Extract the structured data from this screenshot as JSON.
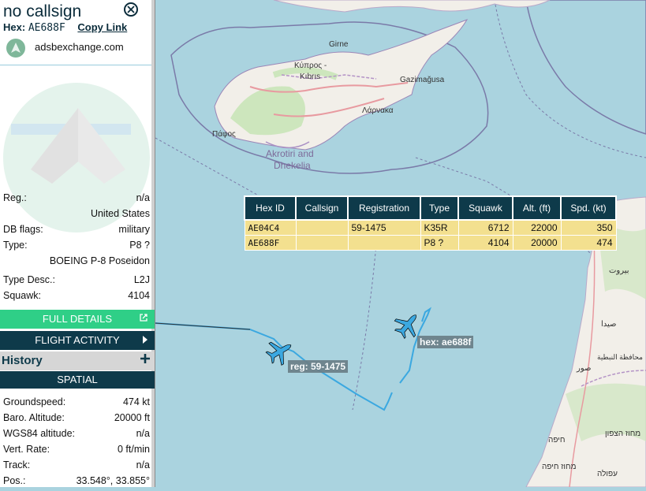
{
  "detail": {
    "callsign": "no callsign",
    "hex_label": "Hex:",
    "hex_value": "AE688F",
    "copy_link": "Copy Link",
    "source": "adsbexchange.com"
  },
  "fields": {
    "reg_label": "Reg.:",
    "reg_value": "n/a",
    "country": "United States",
    "dbflags_label": "DB flags:",
    "dbflags_value": "military",
    "type_label": "Type:",
    "type_value": "P8 ?",
    "type_full": "BOEING P-8 Poseidon",
    "typedesc_label": "Type Desc.:",
    "typedesc_value": "L2J",
    "squawk_label": "Squawk:",
    "squawk_value": "4104"
  },
  "buttons": {
    "full_details": "FULL DETAILS",
    "flight_activity": "FLIGHT ACTIVITY",
    "history": "History",
    "spatial": "SPATIAL"
  },
  "spatial": {
    "groundspeed_label": "Groundspeed:",
    "groundspeed_value": "474 kt",
    "baro_label": "Baro. Altitude:",
    "baro_value": "20000 ft",
    "wgs_label": "WGS84 altitude:",
    "wgs_value": "n/a",
    "vert_label": "Vert. Rate:",
    "vert_value": "0 ft/min",
    "track_label": "Track:",
    "track_value": "n/a",
    "pos_label": "Pos.:",
    "pos_value": "33.548°, 33.855°"
  },
  "table": {
    "headers": [
      "Hex ID",
      "Callsign",
      "Registration",
      "Type",
      "Squawk",
      "Alt. (ft)",
      "Spd. (kt)"
    ],
    "rows": [
      [
        "AE04C4",
        "",
        "59-1475",
        "K35R",
        "6712",
        "22000",
        "350"
      ],
      [
        "AE688F",
        "",
        "",
        "P8 ?",
        "4104",
        "20000",
        "474"
      ]
    ]
  },
  "map_labels": {
    "aircraft1": "reg: 59-1475",
    "aircraft2": "hex: ae688f",
    "place_girne": "Girne",
    "place_kypros": "Κύπρος -",
    "place_kibris": "Kıbrıs",
    "place_gazimagusa": "Gazimağusa",
    "place_larnaka": "Λάρνακα",
    "place_pafos": "Πάφος",
    "place_akrotiri1": "Akrotiri and",
    "place_akrotiri2": "Dhekelia",
    "place_beirut": "بيروت",
    "place_saida": "صيدا",
    "place_nabatieh": "محافظة النبطية",
    "place_sour": "صور",
    "place_haifa": "חיפה",
    "place_north": "מחוז הצפון",
    "place_haifa_dist": "מחוז חיפה",
    "place_afula": "עפולה"
  },
  "colors": {
    "water": "#aad3df",
    "accent_green": "#2fcf87",
    "dark": "#0e3a4a",
    "track": "#3ba8e0",
    "table_row": "#f3e08f"
  },
  "icons": [
    "close-icon",
    "external-link-icon",
    "chevron-right-icon",
    "plus-icon",
    "aircraft-icon"
  ]
}
